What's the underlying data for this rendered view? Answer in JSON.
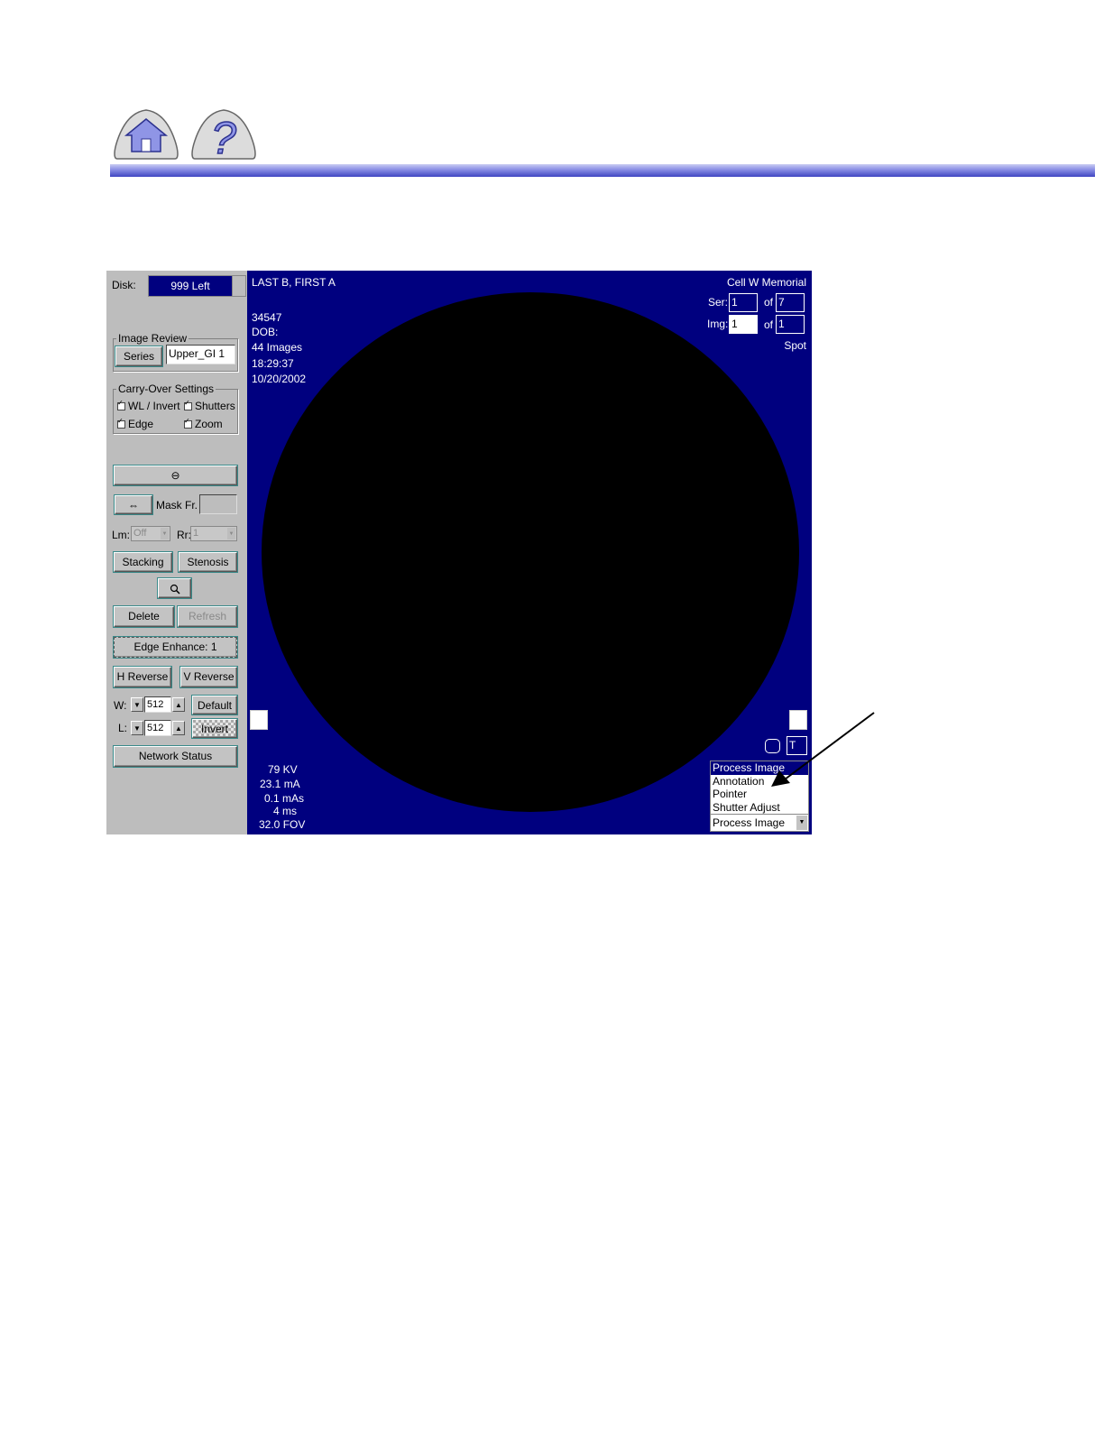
{
  "header": {
    "home_icon": "home-icon",
    "help_icon": "help-icon",
    "help_glyph": "?",
    "rule_color": "#3f45c2"
  },
  "panel": {
    "disk_label": "Disk:",
    "disk_value": "999 Left",
    "image_review": {
      "title": "Image Review",
      "series_button": "Series",
      "series_value": "Upper_GI 1"
    },
    "carry_over": {
      "title": "Carry-Over Settings",
      "wl_invert": "WL / Invert",
      "shutters": "Shutters",
      "edge": "Edge",
      "zoom": "Zoom"
    },
    "subtract_button_glyph": "⊖",
    "link_button_glyph": "⇔",
    "mask_label": "Mask Fr.",
    "lm_label": "Lm:",
    "lm_value": "Off",
    "rr_label": "Rr:",
    "rr_value": "1",
    "stacking_button": "Stacking",
    "stenosis_button": "Stenosis",
    "magnifier_icon": "magnifier-icon",
    "delete_button": "Delete",
    "refresh_button": "Refresh",
    "edge_enhance_label": "Edge Enhance:",
    "edge_enhance_value": "1",
    "h_reverse_button": "H Reverse",
    "v_reverse_button": "V Reverse",
    "w_label": "W:",
    "w_value": "512",
    "default_button": "Default",
    "l_label": "L:",
    "l_value": "512",
    "invert_button": "Invert",
    "network_status_button": "Network Status"
  },
  "viewer": {
    "patient_name": "LAST B, FIRST A",
    "patient_id": "34547",
    "dob_label": "DOB:",
    "image_count": "44 Images",
    "time": "18:29:37",
    "date": "10/20/2002",
    "institution": "Cell W Memorial",
    "ser_label": "Ser:",
    "ser_value": "1",
    "of_label": "of",
    "ser_total": "7",
    "img_label": "Img:",
    "img_value": "1",
    "img_total": "1",
    "mode": "Spot",
    "kv": "79 KV",
    "ma": "23.1 mA",
    "mas": "0.1 mAs",
    "ms": "4 ms",
    "fov_value": "32.0",
    "fov_label": "FOV",
    "text_button": "T",
    "menu_items": [
      "Process Image",
      "Annotation",
      "Pointer",
      "Shutter Adjust"
    ],
    "menu_selected": "Process Image",
    "background_color": "#00007f"
  }
}
